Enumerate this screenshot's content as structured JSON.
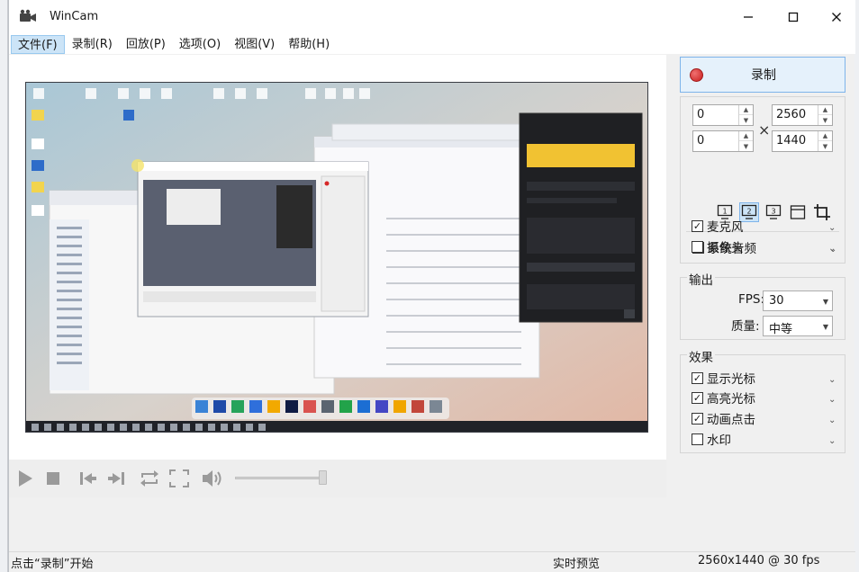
{
  "window": {
    "title": "WinCam"
  },
  "menu": [
    {
      "label": "文件(F)"
    },
    {
      "label": "录制(R)"
    },
    {
      "label": "回放(P)"
    },
    {
      "label": "选项(O)"
    },
    {
      "label": "视图(V)"
    },
    {
      "label": "帮助(H)"
    }
  ],
  "record": {
    "label": "录制"
  },
  "region": {
    "x": "0",
    "y": "0",
    "width": "2560",
    "height": "1440",
    "selected_screen": "2",
    "screens": [
      "1",
      "2",
      "3"
    ]
  },
  "audio": {
    "items": [
      {
        "label": "系统音频",
        "checked": true
      },
      {
        "label": "麦克风",
        "checked": true
      },
      {
        "label": "摄像头",
        "checked": false
      }
    ]
  },
  "output": {
    "title": "输出",
    "fps_label": "FPS:",
    "fps_value": "30",
    "quality_label": "质量:",
    "quality_value": "中等"
  },
  "effects": {
    "title": "效果",
    "items": [
      {
        "label": "显示光标",
        "checked": true
      },
      {
        "label": "高亮光标",
        "checked": true
      },
      {
        "label": "动画点击",
        "checked": true
      },
      {
        "label": "水印",
        "checked": false
      }
    ]
  },
  "status": {
    "left": "点击“录制”开始",
    "middle": "实时预览",
    "right": "2560x1440 @ 30 fps"
  },
  "colors": {
    "accent": "#cce4f7",
    "accent_border": "#7eb4ea",
    "record_red": "#d62828"
  }
}
